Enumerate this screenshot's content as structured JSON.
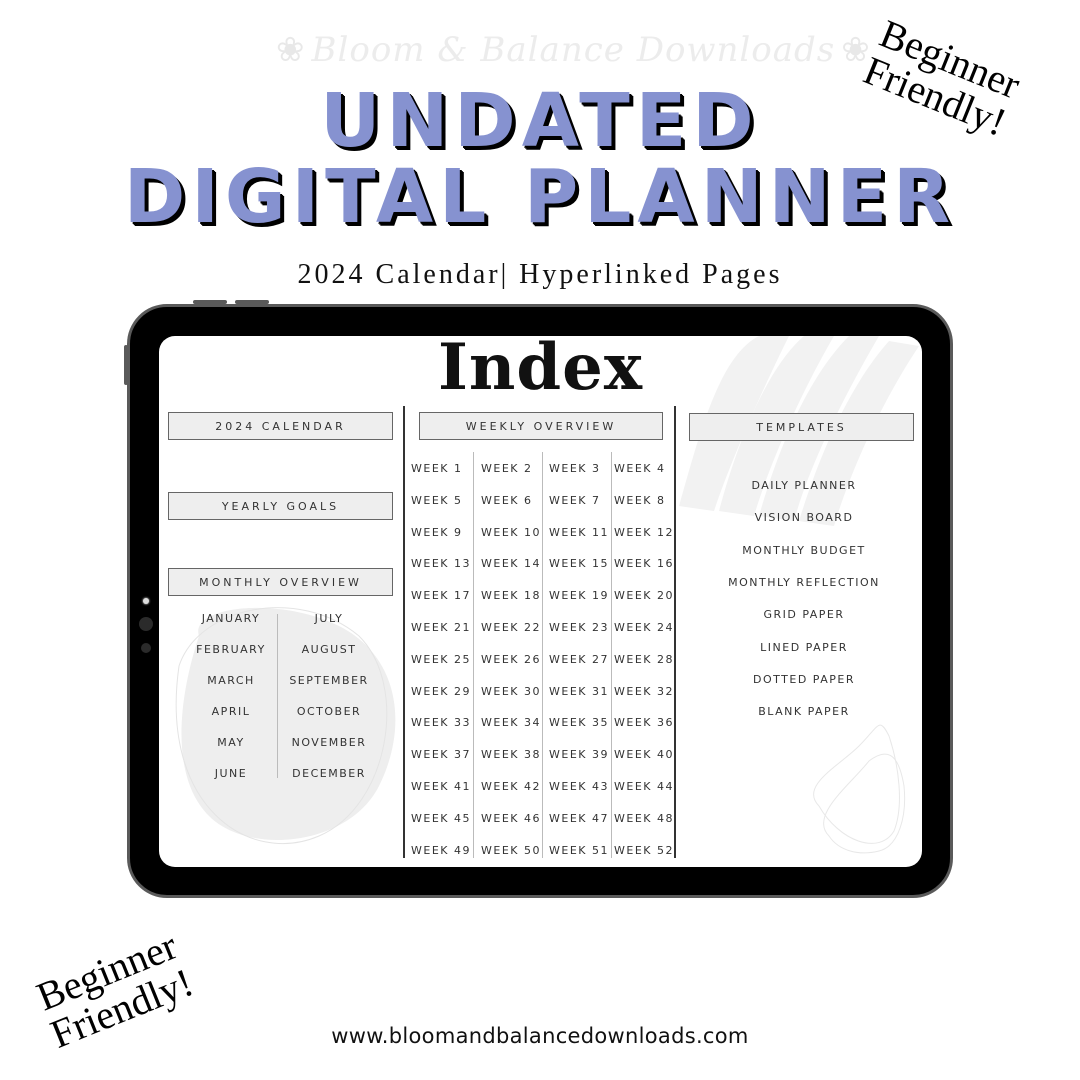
{
  "brand_watermark": "Bloom & Balance Downloads",
  "headline": {
    "line1": "UNDATED",
    "line2": "DIGITAL PLANNER",
    "color": "#8692d0"
  },
  "subtitle": "2024 Calendar| Hyperlinked Pages",
  "stickers": {
    "top_right": {
      "line1": "Beginner",
      "line2": "Friendly!"
    },
    "bottom_left": {
      "line1": "Beginner",
      "line2": "Friendly!"
    }
  },
  "website": "www.bloomandbalancedownloads.com",
  "planner": {
    "title": "Index",
    "left_column": {
      "calendar_label": "2024 CALENDAR",
      "goals_label": "YEARLY GOALS",
      "monthly_label": "MONTHLY OVERVIEW",
      "months_left": [
        "JANUARY",
        "FEBRUARY",
        "MARCH",
        "APRIL",
        "MAY",
        "JUNE"
      ],
      "months_right": [
        "JULY",
        "AUGUST",
        "SEPTEMBER",
        "OCTOBER",
        "NOVEMBER",
        "DECEMBER"
      ]
    },
    "weekly": {
      "label": "WEEKLY OVERVIEW",
      "weeks": [
        "WEEK 1",
        "WEEK 2",
        "WEEK 3",
        "WEEK 4",
        "WEEK 5",
        "WEEK 6",
        "WEEK 7",
        "WEEK 8",
        "WEEK 9",
        "WEEK 10",
        "WEEK 11",
        "WEEK 12",
        "WEEK 13",
        "WEEK 14",
        "WEEK 15",
        "WEEK 16",
        "WEEK 17",
        "WEEK 18",
        "WEEK 19",
        "WEEK 20",
        "WEEK 21",
        "WEEK 22",
        "WEEK 23",
        "WEEK 24",
        "WEEK 25",
        "WEEK 26",
        "WEEK 27",
        "WEEK 28",
        "WEEK 29",
        "WEEK 30",
        "WEEK 31",
        "WEEK 32",
        "WEEK 33",
        "WEEK 34",
        "WEEK 35",
        "WEEK 36",
        "WEEK 37",
        "WEEK 38",
        "WEEK 39",
        "WEEK 40",
        "WEEK 41",
        "WEEK 42",
        "WEEK 43",
        "WEEK 44",
        "WEEK 45",
        "WEEK 46",
        "WEEK 47",
        "WEEK 48",
        "WEEK 49",
        "WEEK 50",
        "WEEK 51",
        "WEEK 52"
      ]
    },
    "templates": {
      "label": "TEMPLATES",
      "items": [
        "DAILY PLANNER",
        "VISION BOARD",
        "MONTHLY BUDGET",
        "MONTHLY REFLECTION",
        "GRID PAPER",
        "LINED PAPER",
        "DOTTED PAPER",
        "BLANK PAPER"
      ]
    }
  }
}
